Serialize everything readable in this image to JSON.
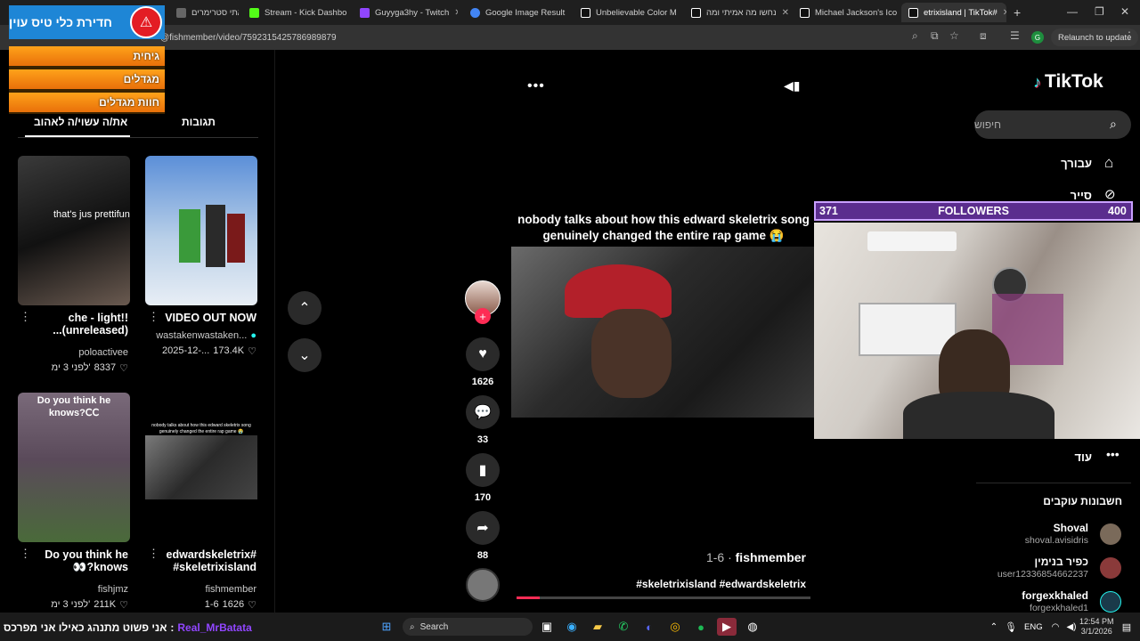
{
  "tabs": [
    {
      "title": "הבאתי סטרימרים",
      "active": false
    },
    {
      "title": "Stream - Kick Dashbo",
      "active": false
    },
    {
      "title": "Guyyga3hy - Twitch",
      "active": false
    },
    {
      "title": "Google Image Result",
      "active": false
    },
    {
      "title": "Unbelievable Color M",
      "active": false
    },
    {
      "title": "נחשו מה אמיתי ומה",
      "active": false
    },
    {
      "title": "Michael Jackson's Ico",
      "active": false
    },
    {
      "title": "etrixisland | TikTok#",
      "active": true
    }
  ],
  "address": {
    "url": "@fishmember/video/7592315425786989879",
    "relaunch": "Relaunch to update"
  },
  "overlay": {
    "title": "חדירת כלי טיס עוין",
    "items": [
      "גיחית",
      "מגדלים",
      "חוות מגדלים"
    ]
  },
  "left_panel": {
    "tab_liked": "את/ה עשוי/ה לאהוב",
    "tab_comments": "תגובות",
    "cards": [
      {
        "title": "che - light!! (unreleased)...",
        "author": "poloactivee",
        "stat": "8337",
        "date": "לפני 3 ימ'",
        "overlay_text": "that's jus prettifun"
      },
      {
        "title": "VIDEO OUT NOW",
        "author": "wastakenwastaken...",
        "stat": "173.4K",
        "date": "2025-12-...",
        "overlay_text": ""
      },
      {
        "title": "Do you think he knows?👀",
        "author": "fishjmz",
        "stat": "211K",
        "date": "לפני 3 ימ'",
        "overlay_text": "Do you think he knows?ꓚꓚ"
      },
      {
        "title": "#edwardskeletrix #skeletrixisland",
        "author": "fishmember",
        "stat": "1626",
        "date": "1-6",
        "overlay_text": "nobody talks about how this edward skeletrix song genuinely changed the entire rap game 😭"
      }
    ]
  },
  "video": {
    "caption": "nobody talks about how this edward skeletrix song genuinely changed the entire rap game 😭",
    "author": "fishmember",
    "date": "1-6",
    "tags": "#skeletrixisland #edwardskeletrix",
    "progress": 0.08
  },
  "actions": {
    "likes": "1626",
    "comments": "33",
    "saves": "170",
    "shares": "88"
  },
  "sidebar": {
    "logo": "TikTok",
    "search_placeholder": "חיפוש",
    "nav": [
      "עבורך",
      "סייר"
    ],
    "more": "עוד",
    "following_title": "חשבונות עוקבים",
    "accounts": [
      {
        "name": "Shoval",
        "user": "shoval.avisidris"
      },
      {
        "name": "כפיר בנימין",
        "user": "user12336854662237"
      },
      {
        "name": "forgexkhaled",
        "user": "forgexkhaled1"
      }
    ]
  },
  "followers_bar": {
    "current": "371",
    "label": "FOLLOWERS",
    "goal": "400"
  },
  "taskbar": {
    "chat_user": "Real_MrBatata",
    "chat_msg": "אני פשוט מתנהג כאילו אני מפרכס",
    "search": "Search",
    "lang": "ENG",
    "time": "12:54 PM",
    "date": "3/1/2026"
  },
  "colors": {
    "accent": "#fe2c55",
    "overlay_blue": "#1e86d6",
    "followers_purple": "#5b2d8e"
  }
}
